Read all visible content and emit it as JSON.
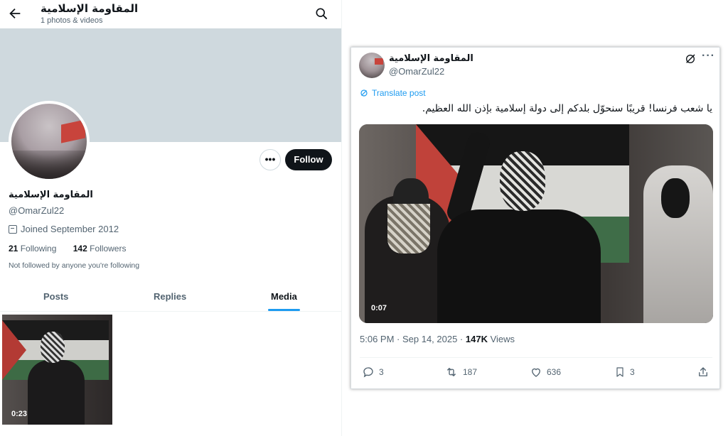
{
  "profile": {
    "header_name": "المقاومة الإسلامية",
    "header_subtitle": "1 photos & videos",
    "name": "المقاومة الإسلامية",
    "handle": "@OmarZul22",
    "joined": "Joined September 2012",
    "following_count": "21",
    "following_label": "Following",
    "followers_count": "142",
    "followers_label": "Followers",
    "not_followed": "Not followed by anyone you're following",
    "follow_label": "Follow",
    "more_label": "•••",
    "tabs": [
      {
        "label": "Posts",
        "active": false
      },
      {
        "label": "Replies",
        "active": false
      },
      {
        "label": "Media",
        "active": true
      }
    ],
    "media": [
      {
        "duration": "0:23"
      }
    ],
    "icons": [
      "back-arrow-icon",
      "search-icon",
      "calendar-icon",
      "more-icon"
    ]
  },
  "tweet": {
    "name": "المقاومة الإسلامية",
    "handle": "@OmarZul22",
    "translate_label": "Translate post",
    "text": "يا شعب فرنسا! قريبًا سنحوّل بلدكم إلى دولة إسلامية بإذن الله العظيم.",
    "video_duration": "0:07",
    "meta_time": "5:06 PM · Sep 14, 2025 · ",
    "meta_views_count": "147K",
    "meta_views_label": " Views",
    "replies": "3",
    "reposts": "187",
    "likes": "636",
    "bookmarks": "3",
    "more_label": "···",
    "icons": [
      "grok-icon",
      "more-icon",
      "translate-icon",
      "reply-icon",
      "repost-icon",
      "like-icon",
      "bookmark-icon",
      "share-icon"
    ]
  },
  "colors": {
    "accent": "#1d9bf0",
    "text_primary": "#0f1419",
    "text_secondary": "#536471",
    "banner": "#cfd9de",
    "follow_button": "#0f1419"
  }
}
